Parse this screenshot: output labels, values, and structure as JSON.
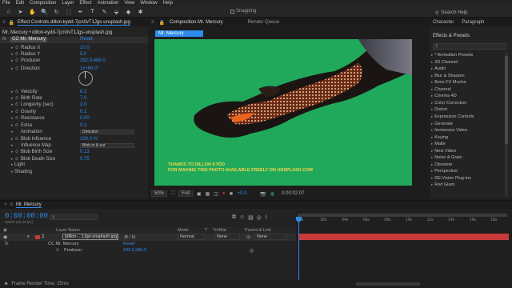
{
  "menu": [
    "File",
    "Edit",
    "Composition",
    "Layer",
    "Effect",
    "Animation",
    "View",
    "Window",
    "Help"
  ],
  "toolbar": {
    "tools": [
      "⌂",
      "➤",
      "✋",
      "🔍",
      "↻",
      "⬚",
      "✒",
      "T",
      "✎",
      "⬙",
      "◆",
      "✱"
    ],
    "snapping_label": "Snapping",
    "search_placeholder": "Search Help"
  },
  "effect_controls": {
    "tab_label": "Effect Controls dillon-kydd-7jcn0vT1Jgs-unsplash.jpg",
    "header": "Mr. Mercury • dillon-kydd-7jcn0vT1Jgs-unsplash.jpg",
    "effect_name": "CC Mr. Mercury",
    "reset_label": "Reset",
    "props": [
      {
        "name": "Radius X",
        "value": "10.0",
        "sw": true
      },
      {
        "name": "Radius Y",
        "value": "5.0",
        "sw": true
      },
      {
        "name": "Producer",
        "value": "292.0,486.0",
        "sw": true
      },
      {
        "name": "Direction",
        "value": "1x+60.0°",
        "sw": true
      },
      {
        "name": "Velocity",
        "value": "6.2",
        "sw": true
      },
      {
        "name": "Birth Rate",
        "value": "7.0",
        "sw": true
      },
      {
        "name": "Longevity (sec)",
        "value": "2.0",
        "sw": true
      },
      {
        "name": "Gravity",
        "value": "0.1",
        "sw": true
      },
      {
        "name": "Resistance",
        "value": "0.00",
        "sw": true
      },
      {
        "name": "Extra",
        "value": "0.1",
        "sw": true
      },
      {
        "name": "Animation",
        "value": "Direction",
        "sw": false,
        "dropdown": true
      },
      {
        "name": "Blob Influence",
        "value": "100.0 %",
        "sw": true
      },
      {
        "name": "Influence Map",
        "value": "Blob in & out",
        "sw": false,
        "dropdown": true
      },
      {
        "name": "Blob Birth Size",
        "value": "0.13",
        "sw": true
      },
      {
        "name": "Blob Death Size",
        "value": "0.75",
        "sw": true
      }
    ],
    "groups": [
      "Light",
      "Shading"
    ]
  },
  "composition": {
    "tab_label": "Composition Mr. Mercury",
    "render_queue_label": "Render Queue",
    "breadcrumb": "Mr. Mercury",
    "credits_line1": "THANKS TO DILLON KYDD",
    "credits_line2": "FOR MAKING THIS PHOTO AVAILABLE FREELY ON UNSPLASH.COM",
    "zoom": "50%",
    "resolution": "Full",
    "exposure": "+0.0",
    "timecode": "0:00:02:07",
    "bg_color": "#21a95b"
  },
  "right_panel": {
    "tabs": [
      "Character",
      "Paragraph"
    ],
    "title": "Effects & Presets",
    "search_placeholder": "",
    "items": [
      "* Animation Presets",
      "3D Channel",
      "Audio",
      "Blur & Sharpen",
      "Boris FX Mocha",
      "Channel",
      "Cinema 4D",
      "Color Correction",
      "Distort",
      "Expression Controls",
      "Generate",
      "Immersive Video",
      "Keying",
      "Matte",
      "Next Video",
      "Noise & Grain",
      "Obsolete",
      "Perspective",
      "RE:Vision Plug-ins",
      "Red Giant"
    ]
  },
  "timeline": {
    "tab_label": "Mr. Mercury",
    "timecode": "0:00:00:00",
    "frame_info": "00000 (25.00 fps)",
    "columns": {
      "layer_name": "Layer Name",
      "mode": "Mode",
      "t": "T",
      "trkmat": "TrkMat",
      "parent": "Parent & Link"
    },
    "layer": {
      "number": "2",
      "name": "[dillon-...1Jgs-unsplash.jpg]",
      "mode": "Normal",
      "trkmat": "None",
      "parent": "None"
    },
    "sub_effect": "CC Mr. Mercury",
    "sub_effect_value": "Reset",
    "sub_prop": "Producer",
    "sub_prop_value": "292.0,486.0",
    "ticks": [
      "0s",
      "02s",
      "04s",
      "06s",
      "08s",
      "10s",
      "12s",
      "14s",
      "16s",
      "18s"
    ],
    "status": "Frame Render Time: 25ms"
  }
}
